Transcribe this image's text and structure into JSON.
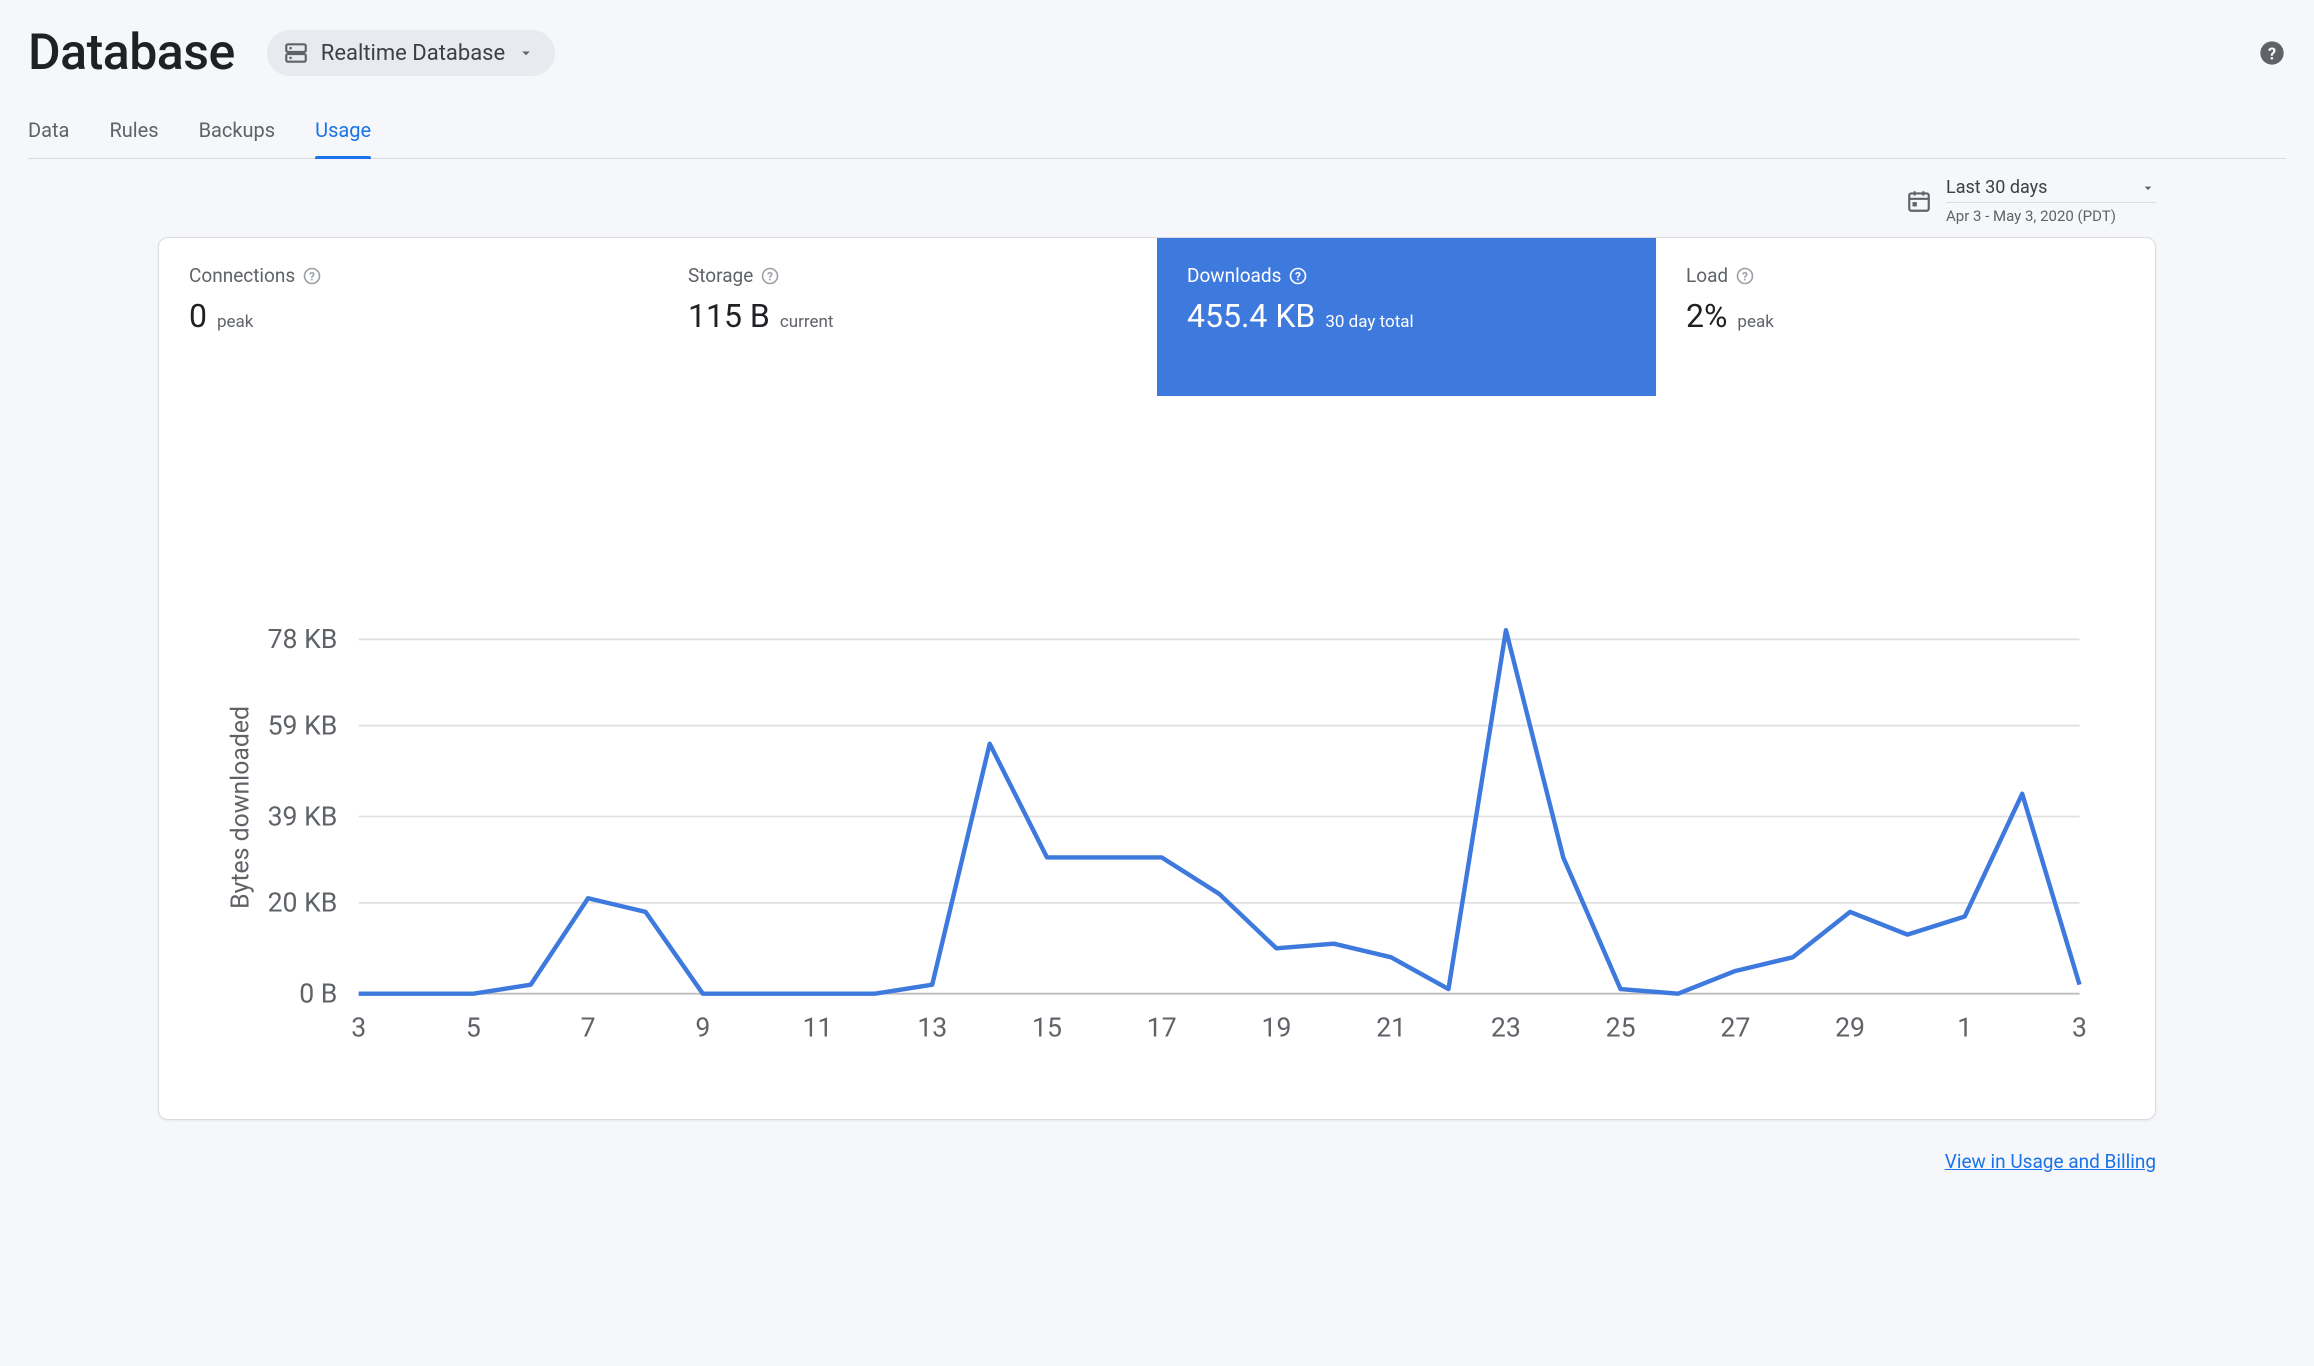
{
  "header": {
    "title": "Database",
    "selector_label": "Realtime Database"
  },
  "tabs": [
    {
      "key": "data",
      "label": "Data",
      "active": false
    },
    {
      "key": "rules",
      "label": "Rules",
      "active": false
    },
    {
      "key": "backups",
      "label": "Backups",
      "active": false
    },
    {
      "key": "usage",
      "label": "Usage",
      "active": true
    }
  ],
  "date": {
    "range_label": "Last 30 days",
    "range_sub": "Apr 3 - May 3, 2020 (PDT)"
  },
  "metrics": {
    "connections": {
      "title": "Connections",
      "value": "0",
      "sub": "peak",
      "selected": false
    },
    "storage": {
      "title": "Storage",
      "value": "115 B",
      "sub": "current",
      "selected": false
    },
    "downloads": {
      "title": "Downloads",
      "value": "455.4 KB",
      "sub": "30 day total",
      "selected": true
    },
    "load": {
      "title": "Load",
      "value": "2%",
      "sub": "peak",
      "selected": false
    }
  },
  "footer": {
    "link_label": "View in Usage and Billing"
  },
  "chart_data": {
    "type": "line",
    "title": "",
    "xlabel": "",
    "ylabel": "Bytes downloaded",
    "y_ticks": [
      "0 B",
      "20 KB",
      "39 KB",
      "59 KB",
      "78 KB"
    ],
    "y_tick_values": [
      0,
      20,
      39,
      59,
      78
    ],
    "ylim": [
      0,
      82
    ],
    "x_tick_labels": [
      "3",
      "5",
      "7",
      "9",
      "11",
      "13",
      "15",
      "17",
      "19",
      "21",
      "23",
      "25",
      "27",
      "29",
      "1",
      "3"
    ],
    "x": [
      3,
      4,
      5,
      6,
      7,
      8,
      9,
      10,
      11,
      12,
      13,
      14,
      15,
      16,
      17,
      18,
      19,
      20,
      21,
      22,
      23,
      24,
      25,
      26,
      27,
      28,
      29,
      30,
      1,
      2,
      3
    ],
    "values_kb": [
      0,
      0,
      0,
      2,
      21,
      18,
      0,
      0,
      0,
      0,
      2,
      55,
      30,
      30,
      30,
      22,
      10,
      11,
      8,
      1,
      80,
      30,
      1,
      0,
      5,
      8,
      18,
      13,
      17,
      44,
      2
    ],
    "unit": "KB"
  }
}
